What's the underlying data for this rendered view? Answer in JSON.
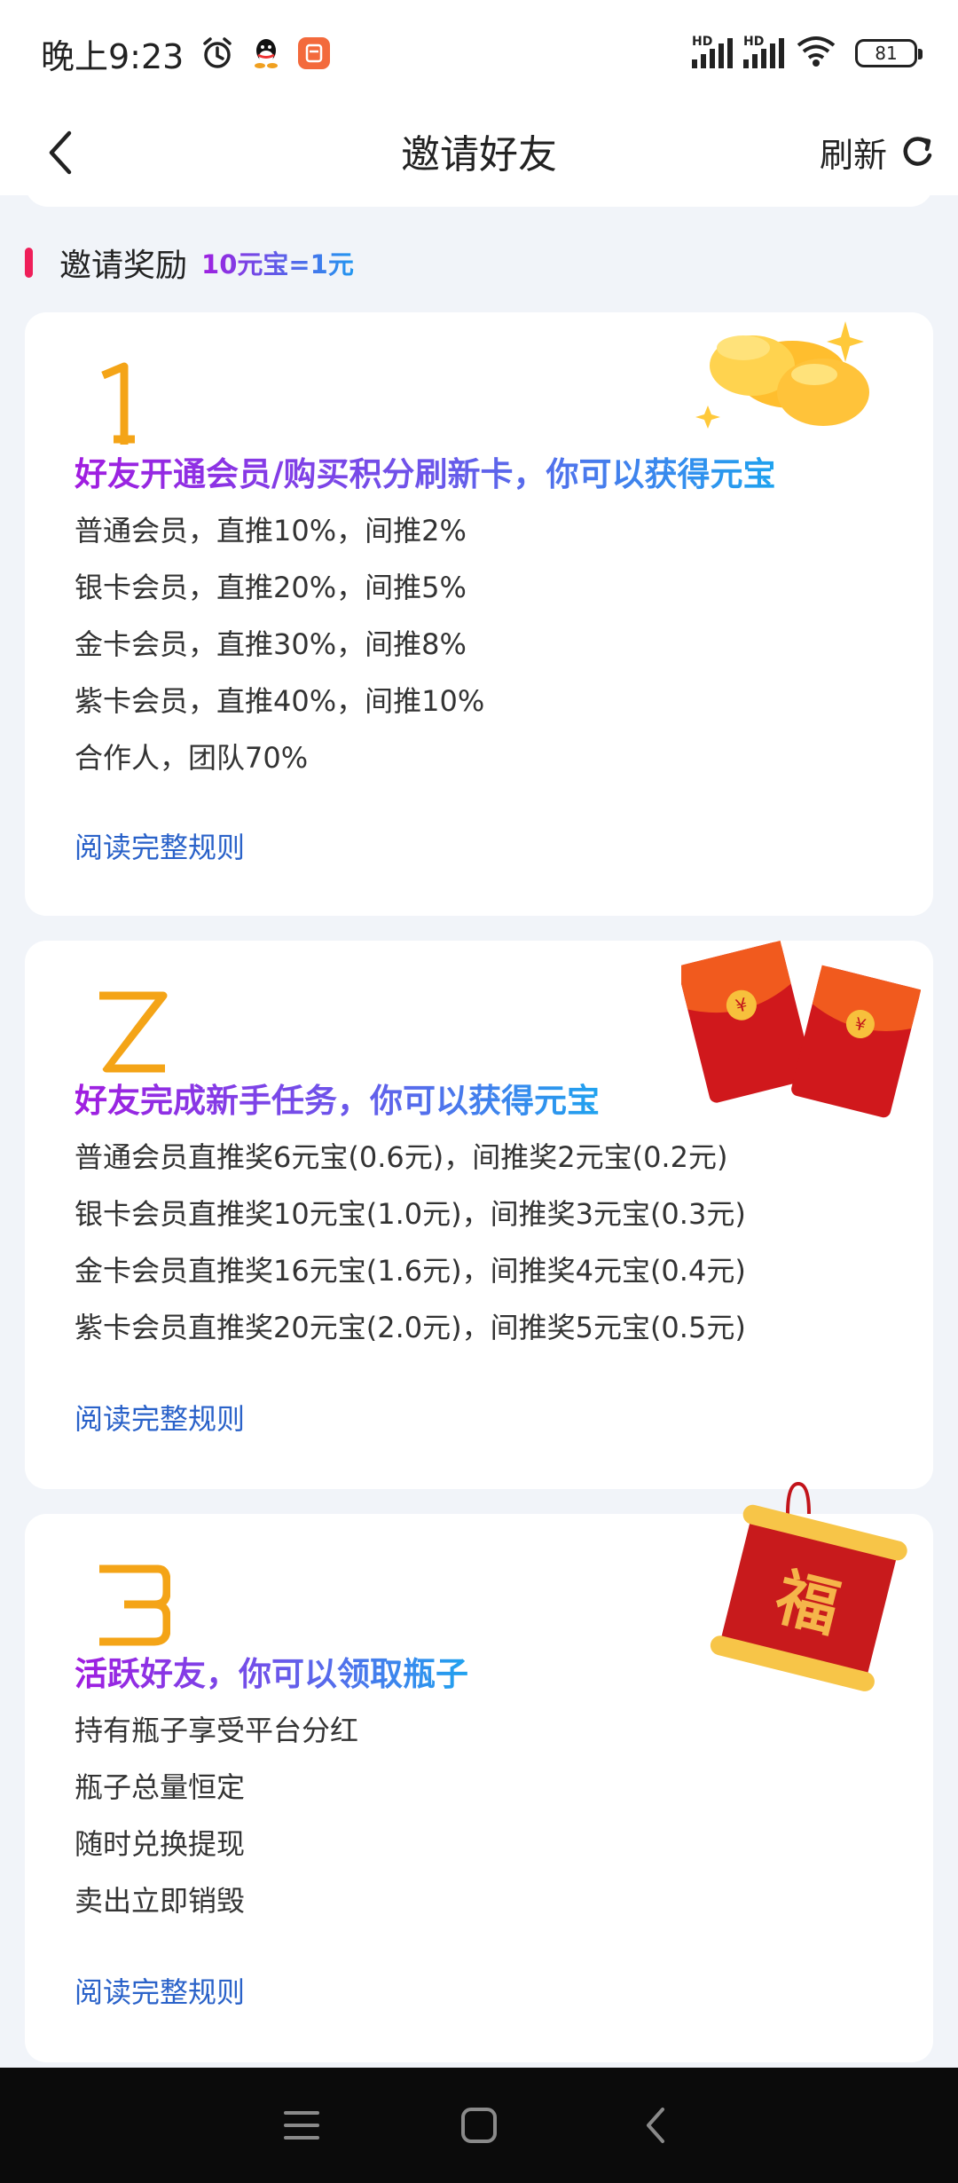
{
  "status_bar": {
    "time": "晚上9:23",
    "signal_label_1": "HD",
    "signal_label_2": "HD",
    "battery": "81"
  },
  "nav": {
    "title": "邀请好友",
    "refresh_label": "刷新"
  },
  "section": {
    "title": "邀请奖励",
    "rate": "10元宝=1元"
  },
  "cards": [
    {
      "heading": "好友开通会员/购买积分刷新卡，你可以获得元宝",
      "lines": [
        "普通会员，直推10%，间推2%",
        "银卡会员，直推20%，间推5%",
        "金卡会员，直推30%，间推8%",
        "紫卡会员，直推40%，间推10%",
        "合作人，团队70%"
      ],
      "link": "阅读完整规则"
    },
    {
      "heading": "好友完成新手任务，你可以获得元宝",
      "lines": [
        "普通会员直推奖6元宝(0.6元)，间推奖2元宝(0.2元)",
        "银卡会员直推奖10元宝(1.0元)，间推奖3元宝(0.3元)",
        "金卡会员直推奖16元宝(1.6元)，间推奖4元宝(0.4元)",
        "紫卡会员直推奖20元宝(2.0元)，间推奖5元宝(0.5元)"
      ],
      "link": "阅读完整规则"
    },
    {
      "heading": "活跃好友，你可以领取瓶子",
      "lines": [
        "持有瓶子享受平台分红",
        "瓶子总量恒定",
        "随时兑换提现",
        "卖出立即销毁"
      ],
      "link": "阅读完整规则",
      "art_char": "福"
    }
  ],
  "colors": {
    "accent_red": "#ef1f5a",
    "link_blue": "#2a62c9",
    "gradient_start": "#a11ce0",
    "gradient_end": "#1fa3ef"
  }
}
